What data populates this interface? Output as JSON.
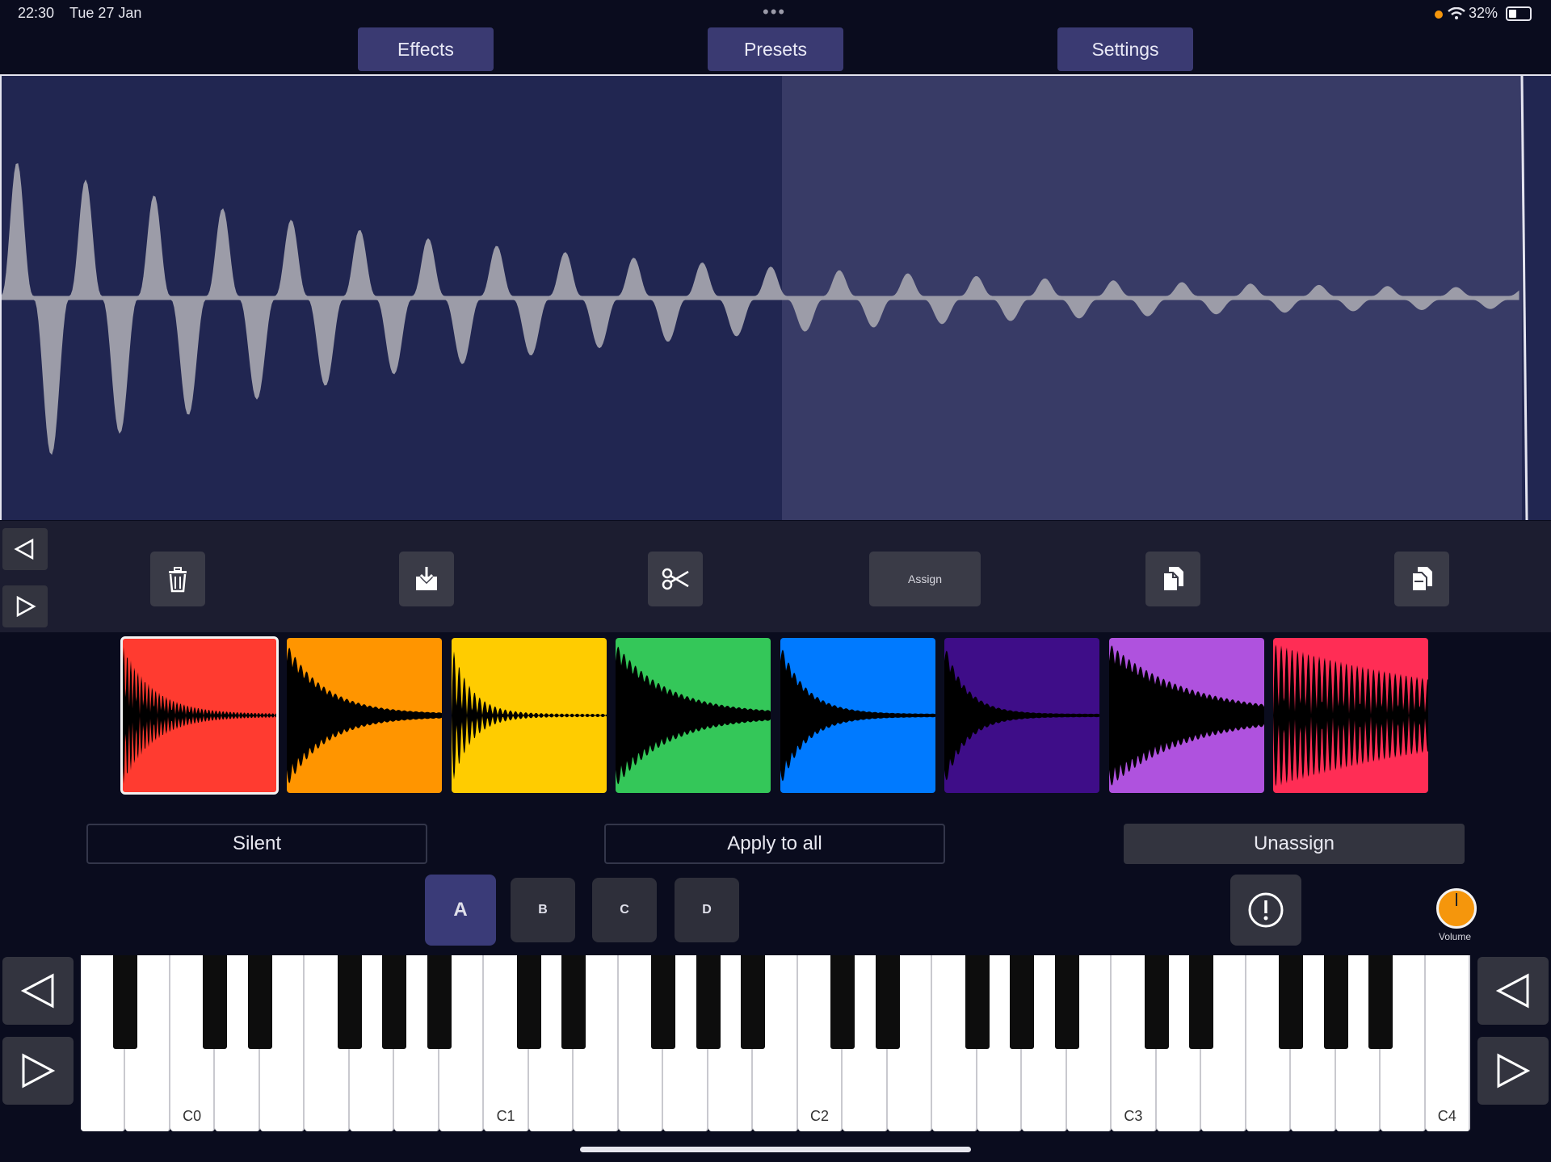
{
  "status_bar": {
    "time": "22:30",
    "date": "Tue 27 Jan",
    "battery": "32%",
    "dots": "•••"
  },
  "tabs": [
    {
      "label": "Effects"
    },
    {
      "label": "Presets"
    },
    {
      "label": "Settings"
    }
  ],
  "toolbar": {
    "assign_label": "Assign"
  },
  "pads": [
    {
      "color": "#ff3b30"
    },
    {
      "color": "#ff9500"
    },
    {
      "color": "#ffcc00"
    },
    {
      "color": "#34c759"
    },
    {
      "color": "#007aff"
    },
    {
      "color": "#3e0d88"
    },
    {
      "color": "#af52de"
    },
    {
      "color": "#ff2d55"
    }
  ],
  "actions": {
    "silent": "Silent",
    "apply_all": "Apply to all",
    "unassign": "Unassign"
  },
  "banks": [
    {
      "label": "A"
    },
    {
      "label": "B"
    },
    {
      "label": "C"
    },
    {
      "label": "D"
    }
  ],
  "volume": {
    "label": "Volume"
  },
  "keyboard": {
    "octave_labels": [
      "C0",
      "C1",
      "C2",
      "C3",
      "C4"
    ]
  }
}
